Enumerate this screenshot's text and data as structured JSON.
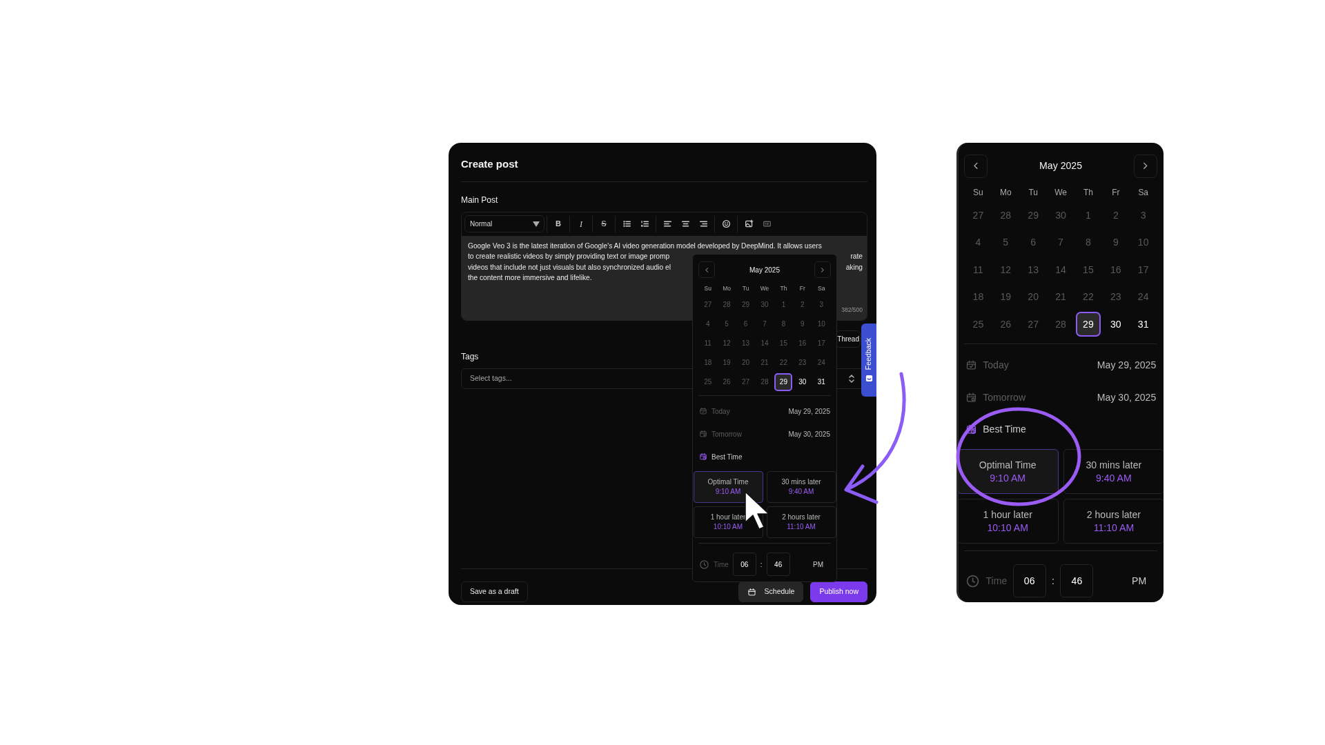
{
  "post": {
    "title": "Create post",
    "section_label": "Main Post",
    "toolbar": {
      "format": "Normal",
      "marks": [
        "B",
        "I",
        "S"
      ]
    },
    "text_lines": [
      {
        "left": "Google Veo 3 is the latest iteration of Google's AI video generation model developed by DeepMind. It allows users"
      },
      {
        "left": "to create realistic videos by simply providing text or image promp",
        "right": "rate"
      },
      {
        "left": "videos that include not just visuals but also synchronized audio el",
        "right": "aking"
      },
      {
        "left": "the content more immersive and lifelike."
      }
    ],
    "char_count": "382/500",
    "thread_button": "Thread",
    "tags_label": "Tags",
    "tags_placeholder": "Select tags...",
    "footer": {
      "draft": "Save as a draft",
      "schedule": "Schedule",
      "publish": "Publish now"
    },
    "feedback": "Feedback",
    "picker": {
      "month": "May 2025",
      "weekdays": [
        "Su",
        "Mo",
        "Tu",
        "We",
        "Th",
        "Fr",
        "Sa"
      ],
      "days": [
        {
          "label": "27",
          "past": true,
          "selected": false
        },
        {
          "label": "28",
          "past": true,
          "selected": false
        },
        {
          "label": "29",
          "past": true,
          "selected": false
        },
        {
          "label": "30",
          "past": true,
          "selected": false
        },
        {
          "label": "1",
          "past": true,
          "selected": false
        },
        {
          "label": "2",
          "past": true,
          "selected": false
        },
        {
          "label": "3",
          "past": true,
          "selected": false
        },
        {
          "label": "4",
          "past": true,
          "selected": false
        },
        {
          "label": "5",
          "past": true,
          "selected": false
        },
        {
          "label": "6",
          "past": true,
          "selected": false
        },
        {
          "label": "7",
          "past": true,
          "selected": false
        },
        {
          "label": "8",
          "past": true,
          "selected": false
        },
        {
          "label": "9",
          "past": true,
          "selected": false
        },
        {
          "label": "10",
          "past": true,
          "selected": false
        },
        {
          "label": "11",
          "past": true,
          "selected": false
        },
        {
          "label": "12",
          "past": true,
          "selected": false
        },
        {
          "label": "13",
          "past": true,
          "selected": false
        },
        {
          "label": "14",
          "past": true,
          "selected": false
        },
        {
          "label": "15",
          "past": true,
          "selected": false
        },
        {
          "label": "16",
          "past": true,
          "selected": false
        },
        {
          "label": "17",
          "past": true,
          "selected": false
        },
        {
          "label": "18",
          "past": true,
          "selected": false
        },
        {
          "label": "19",
          "past": true,
          "selected": false
        },
        {
          "label": "20",
          "past": true,
          "selected": false
        },
        {
          "label": "21",
          "past": true,
          "selected": false
        },
        {
          "label": "22",
          "past": true,
          "selected": false
        },
        {
          "label": "23",
          "past": true,
          "selected": false
        },
        {
          "label": "24",
          "past": true,
          "selected": false
        },
        {
          "label": "25",
          "past": true,
          "selected": false
        },
        {
          "label": "26",
          "past": true,
          "selected": false
        },
        {
          "label": "27",
          "past": true,
          "selected": false
        },
        {
          "label": "28",
          "past": true,
          "selected": false
        },
        {
          "label": "29",
          "past": false,
          "selected": true
        },
        {
          "label": "30",
          "past": false,
          "selected": false
        },
        {
          "label": "31",
          "past": false,
          "selected": false
        }
      ],
      "shortcuts": [
        {
          "kind": "today",
          "label": "Today",
          "date": "May 29, 2025"
        },
        {
          "kind": "tomorrow",
          "label": "Tomorrow",
          "date": "May 30, 2025"
        }
      ],
      "best_time_label": "Best Time",
      "slots": [
        {
          "label": "Optimal Time",
          "time": "9:10 AM",
          "selected": true
        },
        {
          "label": "30 mins later",
          "time": "9:40 AM",
          "selected": false
        },
        {
          "label": "1 hour later",
          "time": "10:10 AM",
          "selected": false
        },
        {
          "label": "2 hours later",
          "time": "11:10 AM",
          "selected": false
        }
      ],
      "time": {
        "label": "Time",
        "hour": "06",
        "separator": ":",
        "minute": "46",
        "period": "PM"
      }
    }
  },
  "zoom_picker": {
    "month": "May 2025",
    "weekdays": [
      "Su",
      "Mo",
      "Tu",
      "We",
      "Th",
      "Fr",
      "Sa"
    ],
    "days": [
      {
        "label": "27",
        "past": true,
        "selected": false
      },
      {
        "label": "28",
        "past": true,
        "selected": false
      },
      {
        "label": "29",
        "past": true,
        "selected": false
      },
      {
        "label": "30",
        "past": true,
        "selected": false
      },
      {
        "label": "1",
        "past": true,
        "selected": false
      },
      {
        "label": "2",
        "past": true,
        "selected": false
      },
      {
        "label": "3",
        "past": true,
        "selected": false
      },
      {
        "label": "4",
        "past": true,
        "selected": false
      },
      {
        "label": "5",
        "past": true,
        "selected": false
      },
      {
        "label": "6",
        "past": true,
        "selected": false
      },
      {
        "label": "7",
        "past": true,
        "selected": false
      },
      {
        "label": "8",
        "past": true,
        "selected": false
      },
      {
        "label": "9",
        "past": true,
        "selected": false
      },
      {
        "label": "10",
        "past": true,
        "selected": false
      },
      {
        "label": "11",
        "past": true,
        "selected": false
      },
      {
        "label": "12",
        "past": true,
        "selected": false
      },
      {
        "label": "13",
        "past": true,
        "selected": false
      },
      {
        "label": "14",
        "past": true,
        "selected": false
      },
      {
        "label": "15",
        "past": true,
        "selected": false
      },
      {
        "label": "16",
        "past": true,
        "selected": false
      },
      {
        "label": "17",
        "past": true,
        "selected": false
      },
      {
        "label": "18",
        "past": true,
        "selected": false
      },
      {
        "label": "19",
        "past": true,
        "selected": false
      },
      {
        "label": "20",
        "past": true,
        "selected": false
      },
      {
        "label": "21",
        "past": true,
        "selected": false
      },
      {
        "label": "22",
        "past": true,
        "selected": false
      },
      {
        "label": "23",
        "past": true,
        "selected": false
      },
      {
        "label": "24",
        "past": true,
        "selected": false
      },
      {
        "label": "25",
        "past": true,
        "selected": false
      },
      {
        "label": "26",
        "past": true,
        "selected": false
      },
      {
        "label": "27",
        "past": true,
        "selected": false
      },
      {
        "label": "28",
        "past": true,
        "selected": false
      },
      {
        "label": "29",
        "past": false,
        "selected": true
      },
      {
        "label": "30",
        "past": false,
        "selected": false
      },
      {
        "label": "31",
        "past": false,
        "selected": false
      }
    ],
    "shortcuts": [
      {
        "kind": "today",
        "label": "Today",
        "date": "May 29, 2025"
      },
      {
        "kind": "tomorrow",
        "label": "Tomorrow",
        "date": "May 30, 2025"
      }
    ],
    "best_time_label": "Best Time",
    "slots": [
      {
        "label": "Optimal Time",
        "time": "9:10 AM",
        "selected": true
      },
      {
        "label": "30 mins later",
        "time": "9:40 AM",
        "selected": false
      },
      {
        "label": "1 hour later",
        "time": "10:10 AM",
        "selected": false
      },
      {
        "label": "2 hours later",
        "time": "11:10 AM",
        "selected": false
      }
    ],
    "time": {
      "label": "Time",
      "hour": "06",
      "separator": ":",
      "minute": "46",
      "period": "PM"
    }
  }
}
